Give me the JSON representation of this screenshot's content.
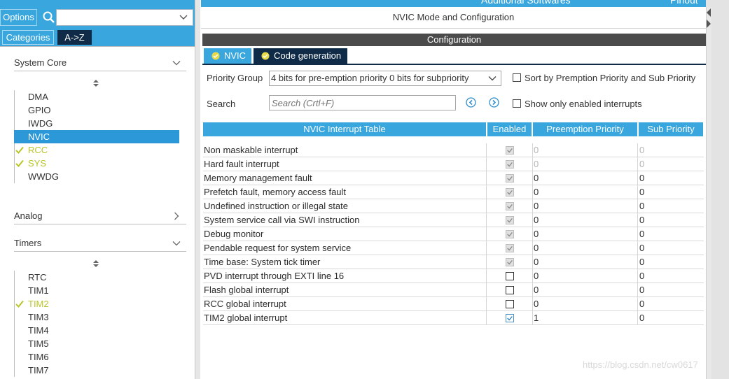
{
  "left_panel": {
    "options_label": "Options",
    "search_value": "",
    "tabs": {
      "categories": "Categories",
      "a_to_z": "A->Z"
    },
    "system_core": {
      "title": "System Core",
      "items": [
        {
          "label": "DMA",
          "state": "normal"
        },
        {
          "label": "GPIO",
          "state": "normal"
        },
        {
          "label": "IWDG",
          "state": "normal"
        },
        {
          "label": "NVIC",
          "state": "selected"
        },
        {
          "label": "RCC",
          "state": "ok"
        },
        {
          "label": "SYS",
          "state": "ok"
        },
        {
          "label": "WWDG",
          "state": "normal"
        }
      ]
    },
    "analog": {
      "title": "Analog"
    },
    "timers": {
      "title": "Timers",
      "items": [
        {
          "label": "RTC",
          "state": "normal"
        },
        {
          "label": "TIM1",
          "state": "normal"
        },
        {
          "label": "TIM2",
          "state": "ok"
        },
        {
          "label": "TIM3",
          "state": "normal"
        },
        {
          "label": "TIM4",
          "state": "normal"
        },
        {
          "label": "TIM5",
          "state": "normal"
        },
        {
          "label": "TIM6",
          "state": "normal"
        },
        {
          "label": "TIM7",
          "state": "normal"
        }
      ]
    }
  },
  "header": {
    "top_left_label": "Additional Softwares",
    "top_right_label": "Pinout",
    "mode_title": "NVIC Mode and Configuration",
    "configuration_label": "Configuration"
  },
  "config_tabs": [
    {
      "label": "NVIC",
      "active": true
    },
    {
      "label": "Code generation",
      "active": false
    }
  ],
  "controls": {
    "priority_group_label": "Priority Group",
    "priority_group_value": "4 bits for pre-emption priority 0 bits for subpriority",
    "sort_label": "Sort by Premption Priority and Sub Priority",
    "search_label": "Search",
    "search_placeholder": "Search (Crtl+F)",
    "show_only_enabled_label": "Show only enabled interrupts"
  },
  "table": {
    "headers": [
      "NVIC Interrupt Table",
      "Enabled",
      "Preemption Priority",
      "Sub Priority"
    ],
    "rows": [
      {
        "name": "Non maskable interrupt",
        "enabled": "locked",
        "preemption": "0",
        "sub": "0",
        "dim": true
      },
      {
        "name": "Hard fault interrupt",
        "enabled": "locked",
        "preemption": "0",
        "sub": "0",
        "dim": true
      },
      {
        "name": "Memory management fault",
        "enabled": "locked",
        "preemption": "0",
        "sub": "0",
        "dim": false
      },
      {
        "name": "Prefetch fault, memory access fault",
        "enabled": "locked",
        "preemption": "0",
        "sub": "0",
        "dim": false
      },
      {
        "name": "Undefined instruction or illegal state",
        "enabled": "locked",
        "preemption": "0",
        "sub": "0",
        "dim": false
      },
      {
        "name": "System service call via SWI instruction",
        "enabled": "locked",
        "preemption": "0",
        "sub": "0",
        "dim": false
      },
      {
        "name": "Debug monitor",
        "enabled": "locked",
        "preemption": "0",
        "sub": "0",
        "dim": false
      },
      {
        "name": "Pendable request for system service",
        "enabled": "locked",
        "preemption": "0",
        "sub": "0",
        "dim": false
      },
      {
        "name": "Time base: System tick timer",
        "enabled": "locked",
        "preemption": "0",
        "sub": "0",
        "dim": false
      },
      {
        "name": "PVD interrupt through EXTI line 16",
        "enabled": "off",
        "preemption": "0",
        "sub": "0",
        "dim": false
      },
      {
        "name": "Flash global interrupt",
        "enabled": "off",
        "preemption": "0",
        "sub": "0",
        "dim": false
      },
      {
        "name": "RCC global interrupt",
        "enabled": "off",
        "preemption": "0",
        "sub": "0",
        "dim": false
      },
      {
        "name": "TIM2 global interrupt",
        "enabled": "on",
        "preemption": "1",
        "sub": "0",
        "dim": false
      }
    ]
  },
  "watermark": "https://blog.csdn.net/cw0617",
  "colors": {
    "accent": "#39a6dd",
    "dark_tab": "#0f2b47",
    "ok_green": "#b9c427",
    "selected": "#2c98d7"
  }
}
